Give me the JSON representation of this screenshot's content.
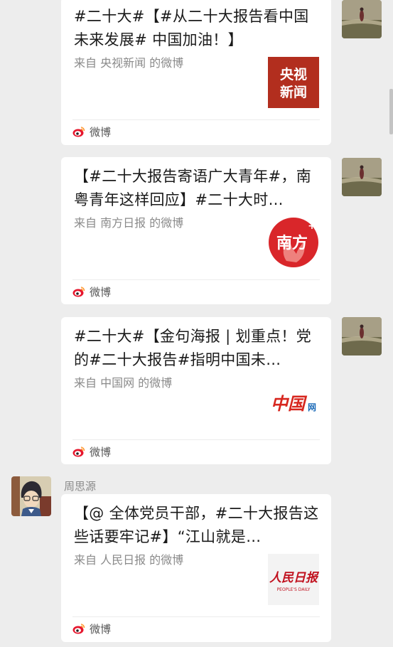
{
  "messages": [
    {
      "title": "#二十大#【#从二十大报告看中国未来发展# 中国加油！】",
      "source": "来自 央视新闻 的微博",
      "footer_label": "微博",
      "thumb_icon": "cctv-news-logo",
      "thumb_text_top": "央视",
      "thumb_text_bottom": "新闻"
    },
    {
      "title": "【#二十大报告寄语广大青年#，南粤青年这样回应】#二十大时…",
      "source": "来自 南方日报 的微博",
      "footer_label": "微博",
      "thumb_icon": "nanfang-daily-logo",
      "thumb_text": "南方"
    },
    {
      "title": "#二十大#【金句海报 | 划重点！党的#二十大报告#指明中国未…",
      "source": "来自 中国网 的微博",
      "footer_label": "微博",
      "thumb_icon": "china-net-logo",
      "thumb_text": "中国",
      "thumb_text_small": "网"
    },
    {
      "title": "【@ 全体党员干部，#二十大报告这些话要牢记#】“江山就是…",
      "source": "来自 人民日报 的微博",
      "footer_label": "微博",
      "thumb_icon": "peoples-daily-logo",
      "thumb_text": "人民日报",
      "thumb_text_small": "PEOPLE'S DAILY"
    }
  ],
  "sender": {
    "name": "周思源"
  },
  "colors": {
    "background": "#ededed",
    "card": "#ffffff",
    "cctv_red": "#b22e1e",
    "nanfang_red": "#d9262a",
    "china_red": "#d7261e",
    "china_blue": "#1c6bb8",
    "peoples_red": "#c1121f",
    "weibo_red": "#e6162d",
    "weibo_yellow": "#ff9933"
  }
}
